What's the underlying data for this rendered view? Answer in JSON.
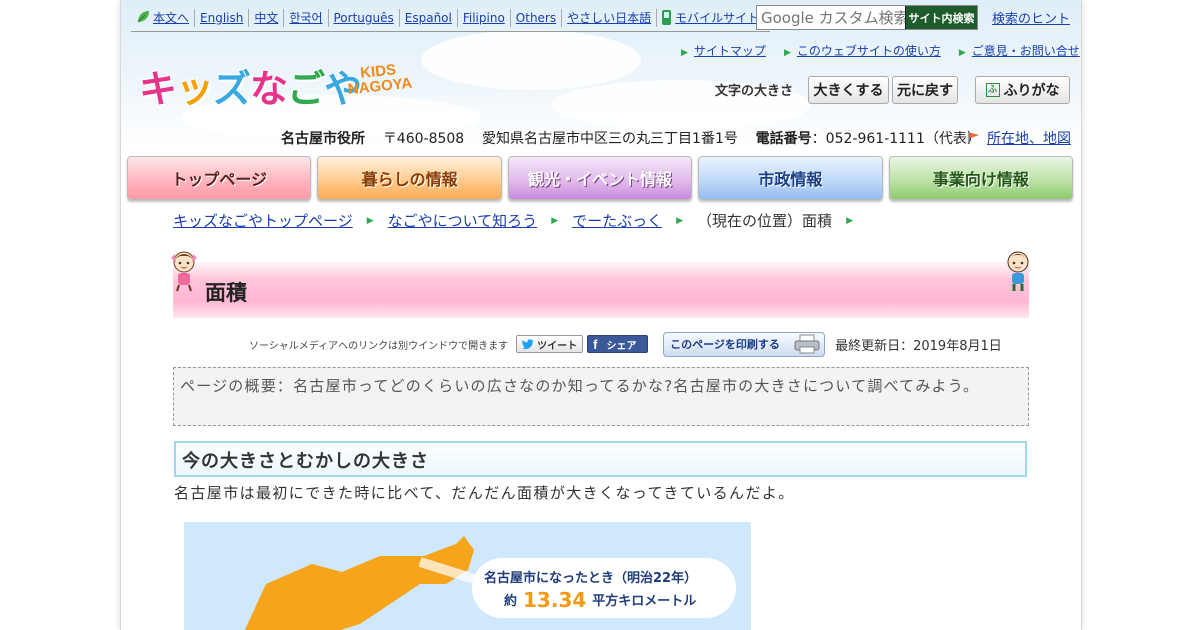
{
  "language_bar": {
    "items": [
      "本文へ",
      "English",
      "中文",
      "한국어",
      "Português",
      "Español",
      "Filipino",
      "Others",
      "やさしい日本語",
      "モバイルサイト"
    ]
  },
  "search": {
    "placeholder": "Google カスタム検索",
    "button_label": "サイト内検索",
    "hint_link": "検索のヒント"
  },
  "utility_links": [
    "サイトマップ",
    "このウェブサイトの使い方",
    "ご意見・お問い合せ"
  ],
  "logo": {
    "text_kids": "キッズなごや",
    "text_latin_1": "KIDS",
    "text_latin_2": "NAGOYA"
  },
  "font_size": {
    "label": "文字の大きさ",
    "bigger": "大きくする",
    "reset": "元に戻す",
    "furigana": "ふりがな"
  },
  "address": {
    "org": "名古屋市役所",
    "postal": "〒460-8508",
    "addr": "愛知県名古屋市中区三の丸三丁目1番1号",
    "phone_label": "電話番号",
    "phone": "：052-961-1111（代表）",
    "map_link": "所在地、地図"
  },
  "nav": [
    "トップページ",
    "暮らしの情報",
    "観光・イベント情報",
    "市政情報",
    "事業向け情報"
  ],
  "breadcrumb": {
    "items": [
      "キッズなごやトップページ",
      "なごやについて知ろう",
      "でーたぶっく"
    ],
    "current": "（現在の位置）面積"
  },
  "page": {
    "title": "面積",
    "share_note": "ソーシャルメディアへのリンクは別ウインドウで開きます",
    "tweet": "ツイート",
    "share": "シェア",
    "print": "このページを印刷する",
    "updated": "最終更新日：2019年8月1日",
    "summary": "ページの概要：名古屋市ってどのくらいの広さなのか知ってるかな?名古屋市の大きさについて調べてみよう。",
    "section_heading": "今の大きさとむかしの大きさ",
    "body": "名古屋市は最初にできた時に比べて、だんだん面積が大きくなってきているんだよ。"
  },
  "figure": {
    "caption_line1": "名古屋市になったとき（明治22年）",
    "caption_prefix": "約",
    "caption_value": "13.34",
    "caption_unit": "平方キロメートル"
  },
  "colors": {
    "link": "#1a3fb0",
    "accent_green": "#2fa84f",
    "title_band": "#ffb7d4",
    "section_border": "#9ed8ea",
    "map_orange": "#f6a41a"
  }
}
